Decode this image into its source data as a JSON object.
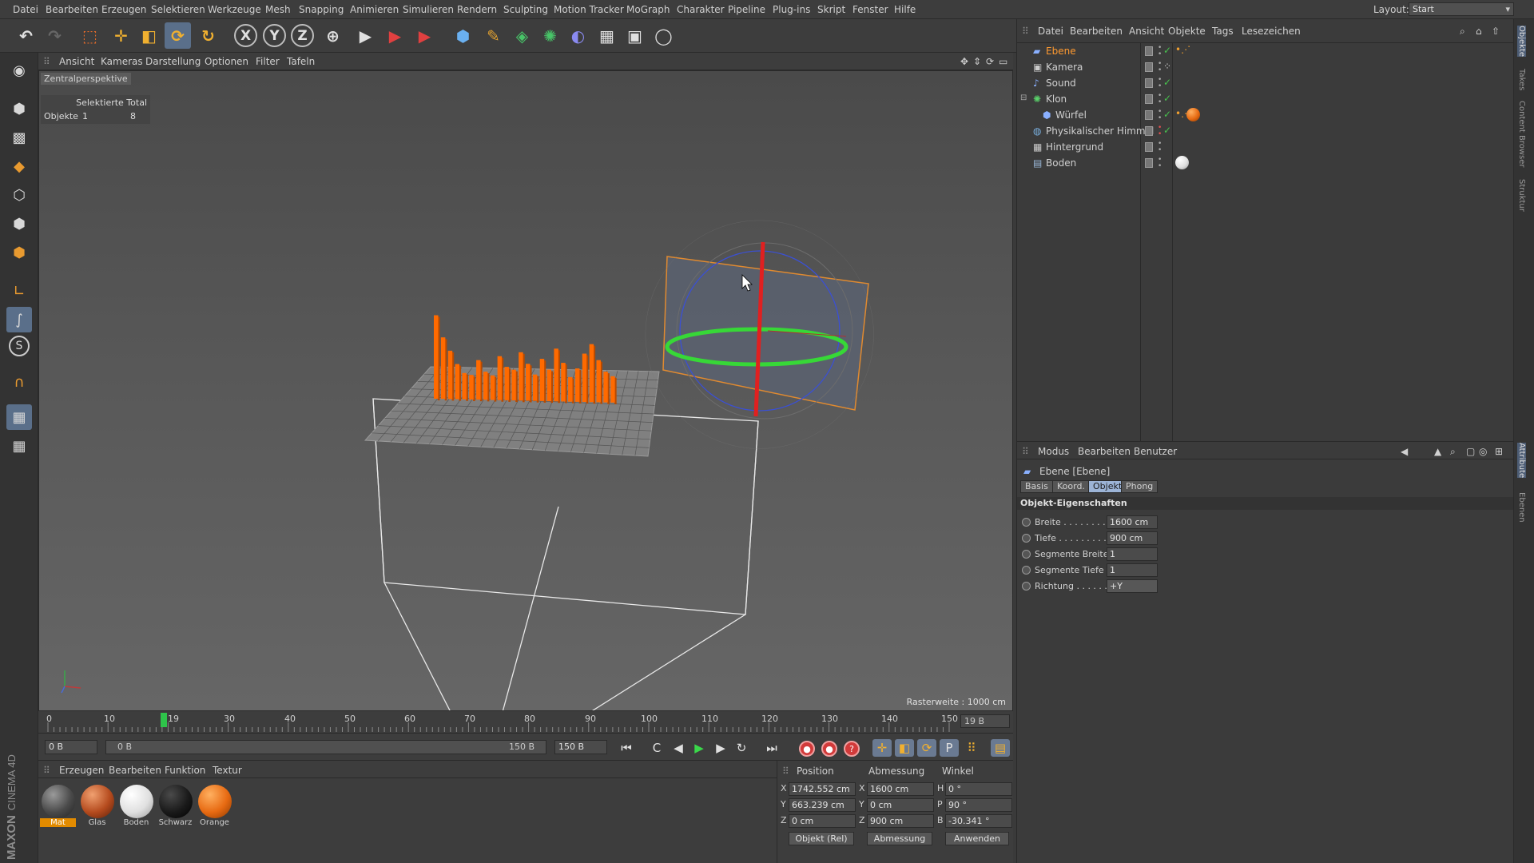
{
  "menubar": {
    "items": [
      "Datei",
      "Bearbeiten",
      "Erzeugen",
      "Selektieren",
      "Werkzeuge",
      "Mesh",
      "Snapping",
      "Animieren",
      "Simulieren",
      "Rendern",
      "Sculpting",
      "Motion Tracker",
      "MoGraph",
      "Charakter",
      "Pipeline",
      "Plug-ins",
      "Skript",
      "Fenster",
      "Hilfe"
    ],
    "layout_label": "Layout:",
    "layout_value": "Start"
  },
  "toolbar": {
    "axis_x": "X",
    "axis_y": "Y",
    "axis_z": "Z"
  },
  "viewport": {
    "menu": [
      "Ansicht",
      "Kameras",
      "Darstellung",
      "Optionen",
      "Filter",
      "Tafeln"
    ],
    "view_name": "Zentralperspektive",
    "info": {
      "header": "Selektierte Total",
      "row_label": "Objekte",
      "selected": "1",
      "total": "8"
    },
    "raster": "Rasterweite : 1000 cm"
  },
  "timeline": {
    "ticks": [
      "0",
      "10",
      "19",
      "30",
      "40",
      "50",
      "60",
      "70",
      "80",
      "90",
      "100",
      "110",
      "120",
      "130",
      "140",
      "150"
    ],
    "current_frame": 19,
    "end_field": "19 B"
  },
  "transport": {
    "start": "0 B",
    "range_start": "0 B",
    "range_end": "150 B",
    "end": "150 B"
  },
  "materials": {
    "menu": [
      "Erzeugen",
      "Bearbeiten",
      "Funktion",
      "Textur"
    ],
    "items": [
      {
        "name": "Mat",
        "color": "#4a4a4a",
        "selected": true
      },
      {
        "name": "Glas",
        "color": "#b54b1e",
        "selected": false
      },
      {
        "name": "Boden",
        "color": "#e8e8e8",
        "selected": false
      },
      {
        "name": "Schwarz",
        "color": "#1a1a1a",
        "selected": false
      },
      {
        "name": "Orange",
        "color": "#e76a12",
        "selected": false
      }
    ]
  },
  "coordinates": {
    "headers": [
      "Position",
      "Abmessung",
      "Winkel"
    ],
    "rows": [
      {
        "axis": "X",
        "pos": "1742.552 cm",
        "size_axis": "X",
        "size": "1600 cm",
        "rot_axis": "H",
        "rot": "0 °"
      },
      {
        "axis": "Y",
        "pos": "663.239 cm",
        "size_axis": "Y",
        "size": "0 cm",
        "rot_axis": "P",
        "rot": "90 °"
      },
      {
        "axis": "Z",
        "pos": "0 cm",
        "size_axis": "Z",
        "size": "900 cm",
        "rot_axis": "B",
        "rot": "-30.341 °"
      }
    ],
    "mode": "Objekt (Rel)",
    "size_mode": "Abmessung",
    "apply": "Anwenden"
  },
  "object_manager": {
    "menu": [
      "Datei",
      "Bearbeiten",
      "Ansicht",
      "Objekte",
      "Tags",
      "Lesezeichen"
    ],
    "objects": [
      {
        "name": "Ebene",
        "icon": "plane-icon",
        "selected": true,
        "indent": 0
      },
      {
        "name": "Kamera",
        "icon": "camera-icon",
        "selected": false,
        "indent": 0
      },
      {
        "name": "Sound",
        "icon": "sound-icon",
        "selected": false,
        "indent": 0
      },
      {
        "name": "Klon",
        "icon": "cloner-icon",
        "selected": false,
        "indent": 0
      },
      {
        "name": "Würfel",
        "icon": "cube-icon",
        "selected": false,
        "indent": 1
      },
      {
        "name": "Physikalischer Himmel",
        "icon": "sky-icon",
        "selected": false,
        "indent": 0
      },
      {
        "name": "Hintergrund",
        "icon": "background-icon",
        "selected": false,
        "indent": 0
      },
      {
        "name": "Boden",
        "icon": "floor-icon",
        "selected": false,
        "indent": 0
      }
    ]
  },
  "attribute_manager": {
    "menu": [
      "Modus",
      "Bearbeiten",
      "Benutzer"
    ],
    "title": "Ebene [Ebene]",
    "tabs": [
      "Basis",
      "Koord.",
      "Objekt",
      "Phong"
    ],
    "active_tab": "Objekt",
    "section": "Objekt-Eigenschaften",
    "props": [
      {
        "label": "Breite . . . . . . . . .",
        "value": "1600 cm"
      },
      {
        "label": "Tiefe . . . . . . . . . .",
        "value": "900 cm"
      },
      {
        "label": "Segmente Breite",
        "value": "1"
      },
      {
        "label": "Segmente Tiefe",
        "value": "1"
      },
      {
        "label": "Richtung . . . . . . .",
        "value": "+Y"
      }
    ]
  },
  "right_edge_tabs": [
    "Objekte",
    "Takes",
    "Content Browser",
    "Struktur",
    "Attribute",
    "Ebenen"
  ],
  "colors": {
    "accent_orange": "#ff9a30",
    "selection_blue": "#5a6f8a",
    "bar_orange": "#ff6a00"
  },
  "chart_data": {
    "type": "bar",
    "values": [
      95,
      70,
      55,
      40,
      30,
      28,
      45,
      32,
      28,
      50,
      38,
      35,
      55,
      42,
      30,
      48,
      36,
      60,
      44,
      28,
      38,
      55,
      66,
      48,
      35,
      30
    ]
  }
}
